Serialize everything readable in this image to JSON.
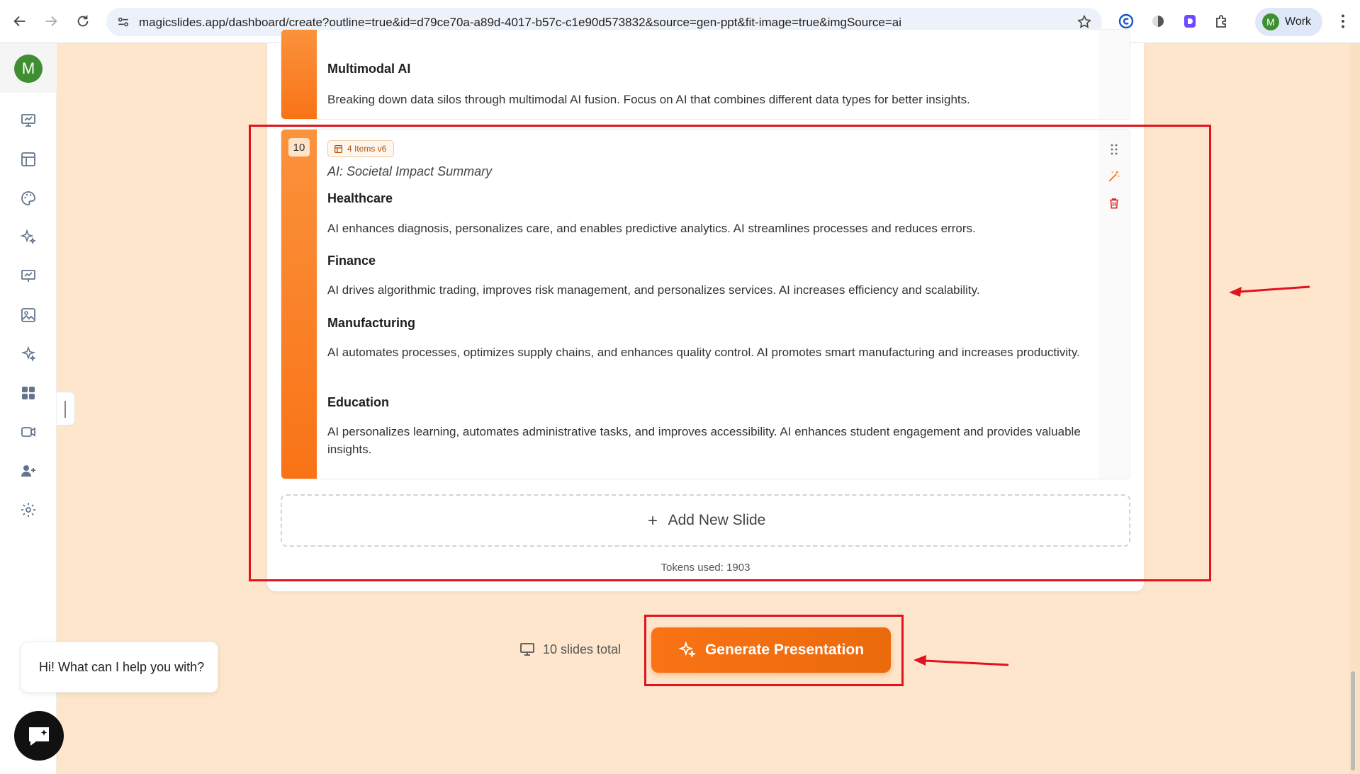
{
  "browser": {
    "url": "magicslides.app/dashboard/create?outline=true&id=d79ce70a-a89d-4017-b57c-c1e90d573832&source=gen-ppt&fit-image=true&imgSource=ai",
    "profile_initial": "M",
    "profile_label": "Work"
  },
  "sidebar": {
    "user_initial": "M",
    "icons": [
      "presentation-icon",
      "layout-icon",
      "palette-icon",
      "sparkle-icon",
      "chart-board-icon",
      "image-icon",
      "magic-icon",
      "apps-icon",
      "video-icon",
      "add-user-icon",
      "settings-icon"
    ]
  },
  "previous_slide": {
    "item_head": "Multimodal AI",
    "item_text": "Breaking down data silos through multimodal AI fusion. Focus on AI that combines different data types for better insights."
  },
  "slide": {
    "number": "10",
    "layout_badge": "4 Items v6",
    "title": "AI: Societal Impact Summary",
    "items": [
      {
        "head": "Healthcare",
        "text": "AI enhances diagnosis, personalizes care, and enables predictive analytics. AI streamlines processes and reduces errors."
      },
      {
        "head": "Finance",
        "text": "AI drives algorithmic trading, improves risk management, and personalizes services. AI increases efficiency and scalability."
      },
      {
        "head": "Manufacturing",
        "text": "AI automates processes, optimizes supply chains, and enhances quality control. AI promotes smart manufacturing and increases productivity."
      },
      {
        "head": "Education",
        "text": "AI personalizes learning, automates administrative tasks, and improves accessibility. AI enhances student engagement and provides valuable insights."
      }
    ]
  },
  "add_slide_label": "Add New Slide",
  "tokens_used": "Tokens used: 1903",
  "slides_total": "10 slides total",
  "generate_label": "Generate Presentation",
  "chat": {
    "greeting": "Hi! What can I help you with?"
  },
  "colors": {
    "accent": "#f97316",
    "annotation": "#e0141e",
    "background": "#fde6cc"
  }
}
